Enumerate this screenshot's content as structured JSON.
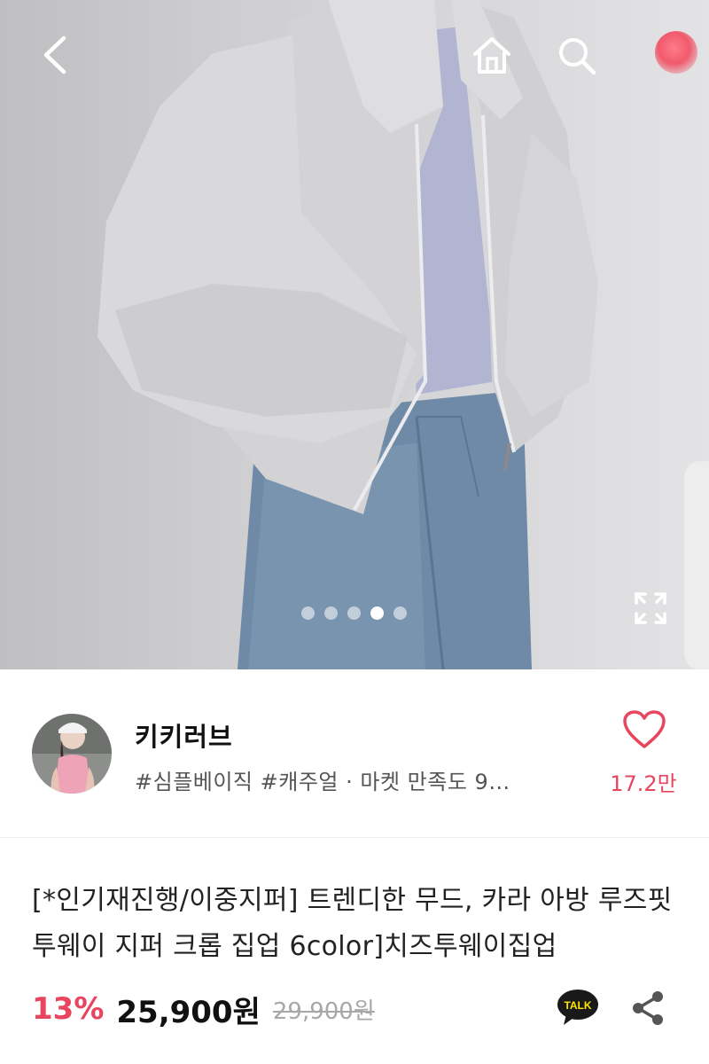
{
  "nav": {
    "back_icon": "chevron-left-icon",
    "home_icon": "home-icon",
    "search_icon": "search-icon",
    "cart_icon": "cart-badge-icon"
  },
  "gallery": {
    "image_count": 5,
    "active_index": 4,
    "expand_icon": "expand-icon"
  },
  "seller": {
    "name": "키키러브",
    "tags": "#심플베이직 #캐주얼 · 마켓 만족도 9…",
    "favorite_count": "17.2만",
    "favorite_icon": "heart-outline-icon"
  },
  "product": {
    "title": "[*인기재진행/이중지퍼] 트렌디한 무드, 카라 아방 루즈핏 투웨이 지퍼 크롭 집업 6color]치즈투웨이집업",
    "discount": "13%",
    "price": "25,900원",
    "original_price": "29,900원"
  },
  "actions": {
    "talk_label": "TALK",
    "share_icon": "share-icon"
  },
  "colors": {
    "accent": "#e8455e",
    "talk_yellow": "#fee500"
  }
}
